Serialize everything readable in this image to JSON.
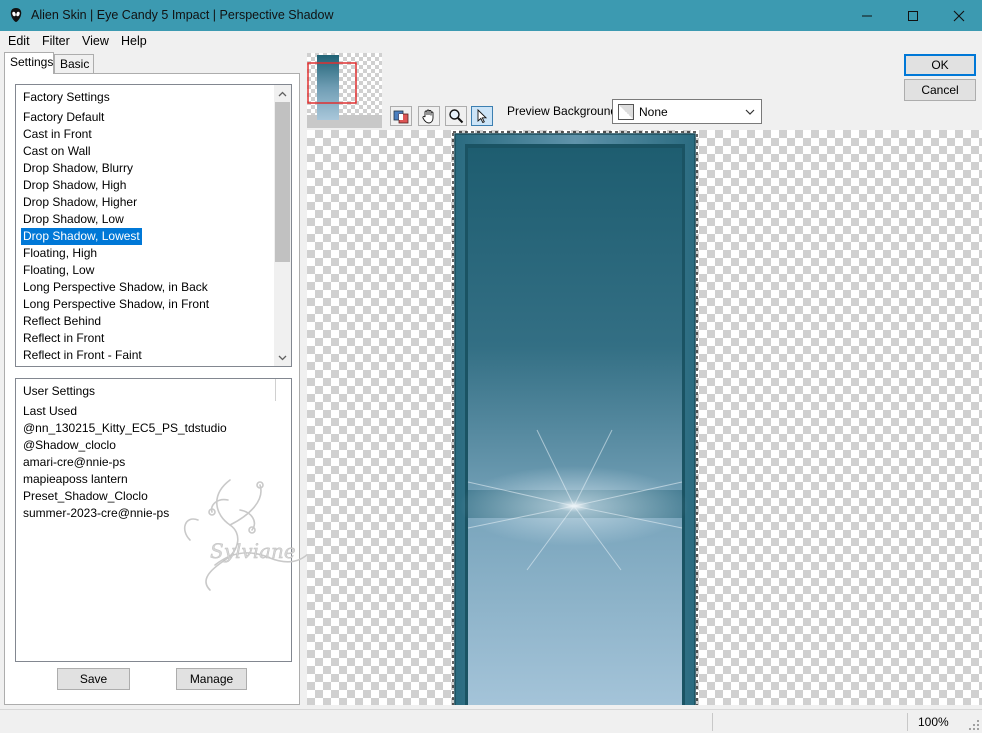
{
  "window": {
    "title": "Alien Skin | Eye Candy 5 Impact | Perspective Shadow"
  },
  "menu": [
    "Edit",
    "Filter",
    "View",
    "Help"
  ],
  "tabs": [
    "Settings",
    "Basic"
  ],
  "factory_settings": {
    "header": "Factory Settings",
    "items": [
      "Factory Default",
      "Cast in Front",
      "Cast on Wall",
      "Drop Shadow, Blurry",
      "Drop Shadow, High",
      "Drop Shadow, Higher",
      "Drop Shadow, Low",
      "Drop Shadow, Lowest",
      "Floating, High",
      "Floating, Low",
      "Long Perspective Shadow, in Back",
      "Long Perspective Shadow, in Front",
      "Reflect Behind",
      "Reflect in Front",
      "Reflect in Front - Faint"
    ],
    "selected": "Drop Shadow, Lowest"
  },
  "user_settings": {
    "header": "User Settings",
    "items": [
      "Last Used",
      "@nn_130215_Kitty_EC5_PS_tdstudio",
      "@Shadow_cloclo",
      "amari-cre@nnie-ps",
      "mapieaposs lantern",
      "Preset_Shadow_Cloclo",
      "summer-2023-cre@nnie-ps"
    ]
  },
  "buttons": {
    "save": "Save",
    "manage": "Manage",
    "ok": "OK",
    "cancel": "Cancel"
  },
  "preview_toolbar": {
    "tools": [
      "preview-compare-icon",
      "hand-icon",
      "zoom-icon",
      "pointer-icon"
    ],
    "active_tool": "pointer-icon"
  },
  "preview_background": {
    "label": "Preview Background:",
    "value": "None"
  },
  "status": {
    "zoom": "100%"
  },
  "watermark_text": "Sylviane",
  "colors": {
    "titlebar": "#3c9ab1",
    "selection": "#0078d7",
    "panel_dark": "#1f5f70",
    "panel_light": "#a9c7da"
  }
}
